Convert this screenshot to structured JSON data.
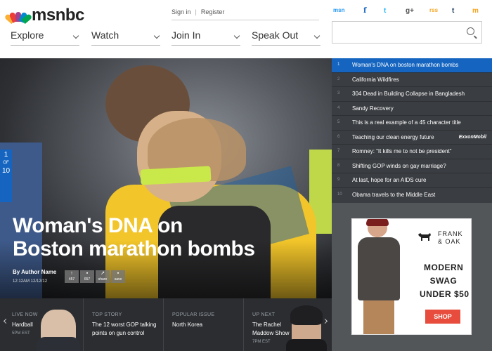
{
  "header": {
    "logo_text": "msnbc",
    "nav": [
      {
        "label": "Explore",
        "has_dropdown": true
      },
      {
        "label": "Watch",
        "has_dropdown": true
      },
      {
        "label": "Join In",
        "has_dropdown": true
      },
      {
        "label": "Speak Out",
        "has_dropdown": true
      }
    ],
    "account": {
      "sign_in": "Sign in",
      "register": "Register"
    },
    "social": [
      {
        "name": "msn",
        "label": "msn",
        "color": "#2196f3"
      },
      {
        "name": "facebook-icon",
        "label": "f",
        "color": "#1565c0"
      },
      {
        "name": "twitter-icon",
        "label": "t",
        "color": "#29b6f6"
      },
      {
        "name": "google-plus-icon",
        "label": "g+",
        "color": "#555555"
      },
      {
        "name": "rss-icon",
        "label": "rss",
        "color": "#f5a623"
      },
      {
        "name": "tumblr-icon",
        "label": "t",
        "color": "#1e3a5f"
      },
      {
        "name": "mobile-icon",
        "label": "m",
        "color": "#f5a623"
      }
    ],
    "search": {
      "placeholder": ""
    }
  },
  "hero": {
    "headline_line1": "Woman's DNA on",
    "headline_line2": "Boston marathon bombs",
    "byline": "By Author Name",
    "date": "12:12AM 12/12/12",
    "pager": {
      "current": "1",
      "of": "OF",
      "total": "10"
    },
    "share_buttons": [
      {
        "icon": "up-arrow-icon",
        "glyph": "↑",
        "label": "457"
      },
      {
        "icon": "comment-icon",
        "glyph": "▪",
        "label": "657"
      },
      {
        "icon": "share-icon",
        "glyph": "↗",
        "label": "share"
      },
      {
        "icon": "save-icon",
        "glyph": "▪",
        "label": "save"
      }
    ]
  },
  "headlines": [
    {
      "num": "1",
      "text": "Woman's DNA on boston marathon bombs",
      "active": true
    },
    {
      "num": "2",
      "text": "California Wildfires"
    },
    {
      "num": "3",
      "text": "304 Dead in Building Collapse in Bangladesh"
    },
    {
      "num": "4",
      "text": "Sandy Recovery"
    },
    {
      "num": "5",
      "text": "This is a real example of a 45 character title"
    },
    {
      "num": "6",
      "text": "Teaching our clean energy future",
      "sponsor": "ExxonMobil"
    },
    {
      "num": "7",
      "text": "Romney: “It kills me to not be president”"
    },
    {
      "num": "8",
      "text": "Shifting GOP winds on gay marriage?"
    },
    {
      "num": "9",
      "text": "At last, hope for an AIDS cure"
    },
    {
      "num": "10",
      "text": "Obama travels to the Middle East"
    }
  ],
  "strip": [
    {
      "kicker": "LIVE NOW",
      "title": "Hardball",
      "time": "5PM EST"
    },
    {
      "kicker": "TOP STORY",
      "title_line1": "The 12 worst GOP talking",
      "title_line2": "points on gun control"
    },
    {
      "kicker": "POPULAR ISSUE",
      "title": "North Korea"
    },
    {
      "kicker": "UP NEXT",
      "title_line1": "The Rachel",
      "title_line2": "Maddow Show",
      "time": "7PM EST"
    }
  ],
  "ad": {
    "brand_line1": "FRANK",
    "brand_line2": "& OAK",
    "copy_line1": "MODERN",
    "copy_line2": "SWAG",
    "copy_line3": "UNDER $50",
    "cta": "SHOP"
  },
  "colors": {
    "accent": "#1565c0",
    "headline_bg": "#3a3d41",
    "strip_bg": "#2b2d30",
    "ad_cta": "#e74c3c"
  }
}
